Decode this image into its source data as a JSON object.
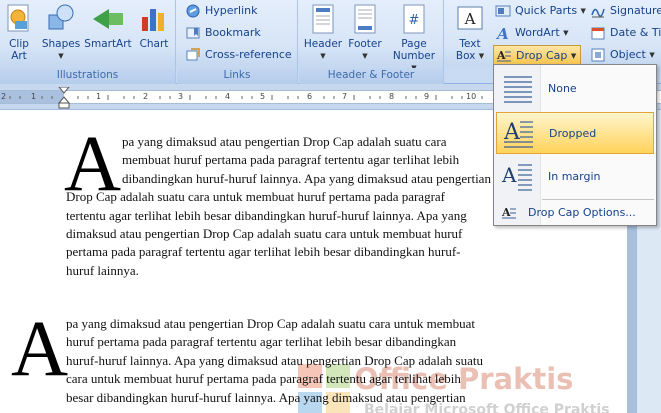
{
  "ribbon": {
    "illustrations": {
      "label": "Illustrations",
      "clip_art": "Clip\nArt",
      "clip_art_l1": "Clip",
      "clip_art_l2": "Art",
      "shapes": "Shapes",
      "smartart": "SmartArt",
      "chart": "Chart"
    },
    "links": {
      "label": "Links",
      "hyperlink": "Hyperlink",
      "bookmark": "Bookmark",
      "cross_reference": "Cross-reference"
    },
    "header_footer": {
      "label": "Header & Footer",
      "header": "Header",
      "footer": "Footer",
      "page_number_l1": "Page",
      "page_number_l2": "Number"
    },
    "text": {
      "text_box_l1": "Text",
      "text_box_l2": "Box",
      "quick_parts": "Quick Parts",
      "wordart": "WordArt",
      "drop_cap": "Drop Cap",
      "signature": "Signature",
      "date_time": "Date & Tim",
      "object": "Object"
    }
  },
  "document": {
    "para1_dropcap": "A",
    "para1_text": "pa yang dimaksud atau pengertian Drop Cap adalah suatu cara untuk membuat huruf pertama pada paragraf tertentu agar terlihat lebih besar dibandingkan huruf-huruf lainnya. Apa yang dimaksud atau pengertian Drop Cap adalah suatu cara untuk membuat huruf pertama pada paragraf tertentu agar terlihat lebih besar dibandingkan huruf-huruf lainnya. Apa yang dimaksud atau pengertian Drop Cap adalah suatu cara untuk membuat huruf pertama pada paragraf tertentu agar terlihat lebih besar dibandingkan huruf-huruf lainnya.",
    "para1_lines": [
      "pa yang dimaksud atau pengertian Drop Cap adalah suatu cara",
      "membuat huruf pertama pada paragraf tertentu agar terlihat lebih",
      "dibandingkan huruf-huruf lainnya. Apa yang dimaksud atau pengertian",
      "Drop Cap adalah suatu cara untuk membuat huruf pertama pada paragraf",
      "tertentu agar terlihat lebih besar dibandingkan huruf-huruf lainnya. Apa yang",
      "dimaksud atau pengertian Drop Cap adalah suatu cara untuk membuat huruf",
      "pertama pada paragraf tertentu agar terlihat lebih besar dibandingkan huruf-",
      "huruf lainnya."
    ],
    "para2_dropcap": "A",
    "para2_lines": [
      "pa yang dimaksud atau pengertian Drop Cap adalah suatu cara untuk membuat",
      "huruf pertama pada paragraf tertentu agar terlihat lebih besar dibandingkan",
      "huruf-huruf lainnya. Apa yang dimaksud atau pengertian Drop Cap adalah suatu",
      "cara untuk membuat huruf pertama pada paragraf tertentu agar terlihat lebih",
      "besar dibandingkan huruf-huruf lainnya. Apa yang dimaksud atau pengertian"
    ],
    "watermark_title": "Office Praktis",
    "watermark_subtitle": "Belajar Microsoft Office Praktis"
  },
  "drop_cap_menu": {
    "none": "None",
    "dropped": "Dropped",
    "in_margin": "In margin",
    "options": "Drop Cap Options..."
  },
  "colors": {
    "ribbon_text": "#15428b",
    "selected_item_bg": "#ffd35b",
    "drop_cap_button_bg": "#fbd36b"
  }
}
